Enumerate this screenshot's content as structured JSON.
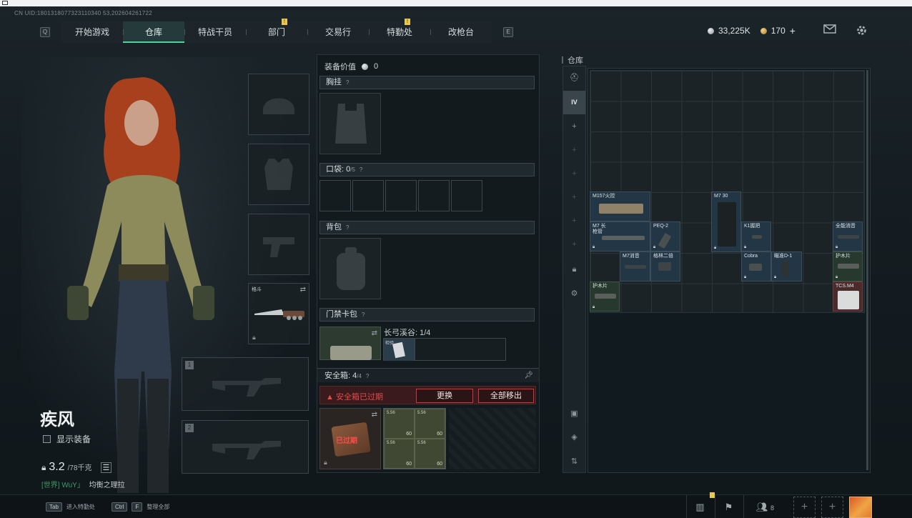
{
  "uid": "CN UID:1801318077323110340 53,202604261722",
  "nav": {
    "left_key": "Q",
    "right_key": "E",
    "tabs": [
      {
        "label": "开始游戏",
        "active": false,
        "flag": false
      },
      {
        "label": "仓库",
        "active": true,
        "flag": false
      },
      {
        "label": "特战干员",
        "active": false,
        "flag": false
      },
      {
        "label": "部门",
        "active": false,
        "flag": true
      },
      {
        "label": "交易行",
        "active": false,
        "flag": false
      },
      {
        "label": "特勤处",
        "active": false,
        "flag": true
      },
      {
        "label": "改枪台",
        "active": false,
        "flag": false
      }
    ],
    "flag_glyph": "!"
  },
  "currency": {
    "silver": "33,225K",
    "gold": "170",
    "add": "+",
    "mail_icon": "mail-icon",
    "settings_icon": "gear-icon"
  },
  "character": {
    "name": "疾风",
    "show_equipment": "显示装备",
    "weight": "3.2",
    "weight_max": "/78千克",
    "chat_channel": "[世界] WuY」",
    "chat_message": "均衡之理拉"
  },
  "slots": {
    "knife_label": "格斗",
    "weapon1_num": "1",
    "weapon2_num": "2"
  },
  "equipment": {
    "value_label": "装备价值",
    "value": "0",
    "chest_rig": "胸挂",
    "pockets": "口袋:",
    "pockets_count": "0",
    "pockets_max": "/5",
    "backpack": "背包",
    "keycard_bag": "门禁卡包",
    "keycard_area": "长弓溪谷: 1/4",
    "keycard_item": "检验",
    "help": "?",
    "safe_label": "安全箱:",
    "safe_count": "4",
    "safe_max": "/4",
    "safe_expired_warning": "安全箱已过期",
    "replace_button": "更换",
    "remove_all_button": "全部移出",
    "safe_expired_stamp": "已过期",
    "ammo": [
      {
        "name": "5.56",
        "count": "60"
      },
      {
        "name": "5.56",
        "count": "60"
      },
      {
        "name": "5.56",
        "count": "60"
      },
      {
        "name": "5.56",
        "count": "60"
      }
    ]
  },
  "warehouse": {
    "title": "仓库",
    "side_tab_label": "IV",
    "items": [
      {
        "name": "M157火控"
      },
      {
        "name": "M7 30"
      },
      {
        "name": "M7 长枪管"
      },
      {
        "name": "PEQ-2"
      },
      {
        "name": "K1握把"
      },
      {
        "name": "全能消音"
      },
      {
        "name": "M7消音"
      },
      {
        "name": "格林二倍"
      },
      {
        "name": "Cobra"
      },
      {
        "name": "瞄准D-1"
      },
      {
        "name": "护木片"
      },
      {
        "name": "护木片"
      },
      {
        "name": "TCS.M4"
      }
    ]
  },
  "bottom": {
    "hint1_key": "Tab",
    "hint1_text": "进入特勤处",
    "hint2_key1": "Ctrl",
    "hint2_key2": "F",
    "hint2_text": "整理全部",
    "friends_count": "8"
  }
}
